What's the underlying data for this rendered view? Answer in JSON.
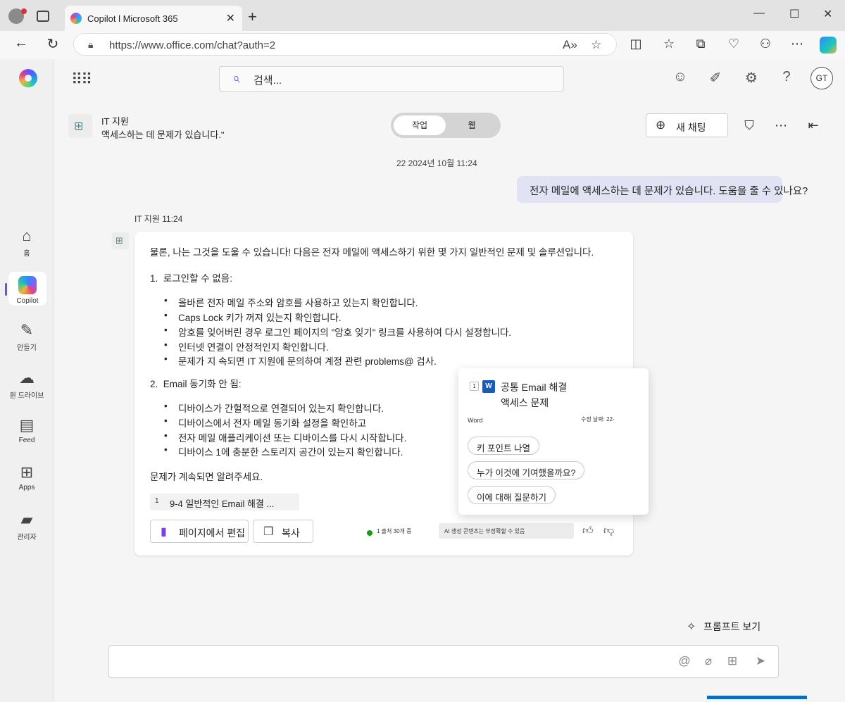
{
  "browser": {
    "tab_title": "Copilot l Microsoft 365",
    "url": "https://www.office.com/chat?auth=2"
  },
  "app_header": {
    "search_placeholder": "검색..."
  },
  "user_avatar": {
    "initials": "GT"
  },
  "rail": {
    "items": [
      {
        "label": "홈",
        "icon": "home-icon"
      },
      {
        "label": "Copilot",
        "icon": "copilot-icon"
      },
      {
        "label": "만들기",
        "icon": "pen-icon"
      },
      {
        "label": "원 드라이브",
        "icon": "cloud-icon"
      },
      {
        "label": "Feed",
        "icon": "feed-icon"
      },
      {
        "label": "Apps",
        "icon": "apps-icon"
      },
      {
        "label": "관리자",
        "icon": "admin-icon"
      }
    ]
  },
  "chat_header": {
    "agent_name": "IT 지원",
    "agent_description": "액세스하는 데 문제가 있습니다.\"",
    "toggle_work": "작업",
    "toggle_web": "웹",
    "new_chat": "새 채팅"
  },
  "conversation": {
    "date": "22 2024년 10월 11:24",
    "user_message": "전자 메일에 액세스하는 데 문제가 있습니다. 도움을 줄 수 있나요?",
    "reply_meta": "IT 지원 11:24",
    "reply": {
      "intro": "물론, 나는 그것을 도울 수 있습니다!  다음은 전자 메일에 액세스하기 위한 몇 가지 일반적인 문제 및 솔루션입니다.",
      "sections": [
        {
          "number": "1.",
          "heading": "로그인할 수 없음:",
          "bullets": [
            "올바른 전자 메일 주소와 암호를 사용하고 있는지 확인합니다.",
            "Caps Lock 키가 꺼져 있는지 확인합니다.",
            "암호를 잊어버린 경우 로그인 페이지의 \"암호 잊기\" 링크를 사용하여 다시 설정합니다.",
            "인터넷 연결이 안정적인지 확인합니다.",
            "문제가 지 속되면 IT 지원에 문의하여 계정 관련 problems@ 검사."
          ]
        },
        {
          "number": "2.",
          "heading": "Email 동기화 안 됨:",
          "bullets": [
            "디바이스가 간헐적으로 연결되어 있는지 확인합니다.",
            "디바이스에서 전자 메일 동기화 설정을 확인하고",
            "전자 메일 애플리케이션 또는 디바이스를 다시 시작합니다.",
            "디바이스 1에 충분한 스토리지 공간이 있는지 확인합니다."
          ]
        }
      ],
      "outro": "문제가 계속되면 알려주세요.",
      "reference": {
        "number": "1",
        "label": "9-4 일반적인 Email 해결 ..."
      },
      "edit_button": "페이지에서 편집",
      "copy_button": "복사",
      "reference_count": "1 출처 30개 중",
      "ai_disclaimer": "AI 생성 콘텐츠는 부정확할 수 있음"
    }
  },
  "popover": {
    "number": "1",
    "title_line1": "공통 Email 해결",
    "title_line2": "액세스 문제",
    "app": "Word",
    "modified": "수정 날짜: 22-",
    "chips": [
      "키 포인트 나열",
      "누가 이것에 기여했을까요?",
      "이에 대해 질문하기"
    ]
  },
  "prompt_link": "프롬프트 보기",
  "colors": {
    "accent": "#5b5fc7",
    "user_bubble": "#e1e3f5",
    "word_blue": "#185abd",
    "status_green": "#13a10e"
  }
}
